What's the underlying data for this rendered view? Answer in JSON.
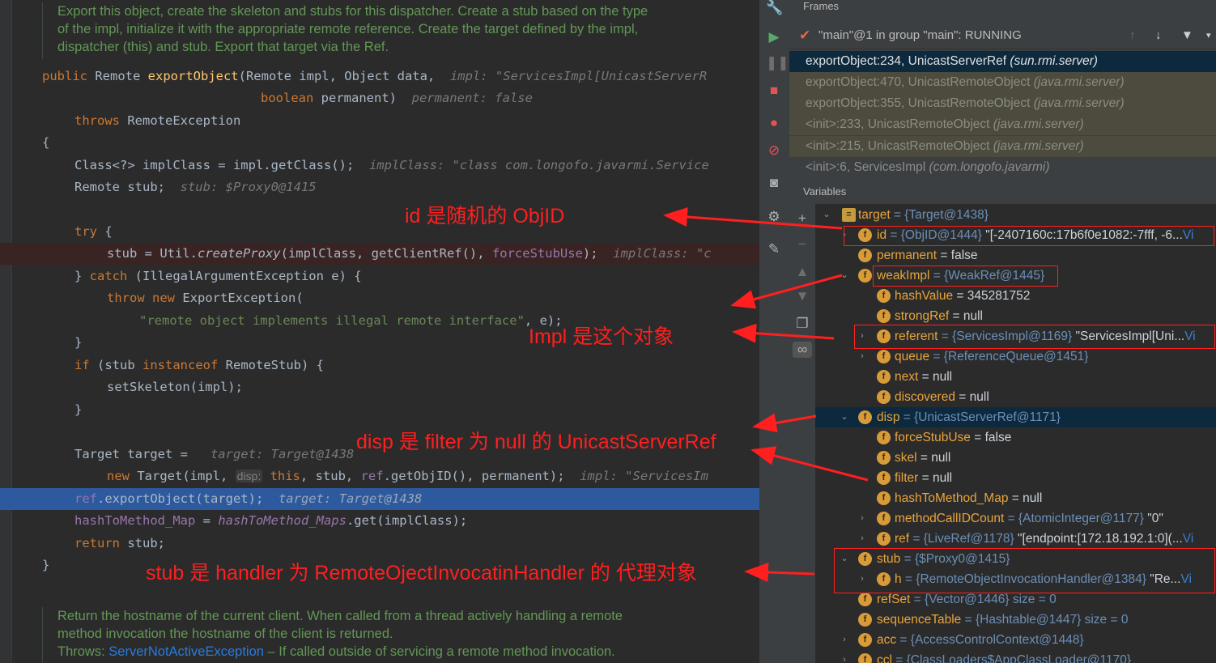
{
  "editor": {
    "doc_top": [
      "Export this object, create the skeleton and stubs for this dispatcher. Create a stub based on the type",
      "of the impl, initialize it with the appropriate remote reference. Create the target defined by the impl,",
      "dispatcher (this) and stub. Export that target via the Ref."
    ],
    "code": {
      "l1_kw": "public",
      "l1_text": " Remote ",
      "l1_fn": "exportObject",
      "l1_rest": "(Remote impl, Object data,",
      "l1_hint": "  impl: \"ServicesImpl[UnicastServerR",
      "l2_kw": "boolean",
      "l2_rest": " permanent)",
      "l2_hint": "  permanent: false",
      "l3_kw": "throws",
      "l3_rest": " RemoteException",
      "l4": "{",
      "l5_code": "Class<?> implClass = impl.getClass();",
      "l5_hint": "  implClass: \"class com.longofo.javarmi.Service",
      "l6_code": "Remote stub;",
      "l6_hint": "  stub: $Proxy0@1415",
      "l7_kw": "try",
      "l7_rest": " {",
      "l8_a": "stub = Util.",
      "l8_fn": "createProxy",
      "l8_b": "(implClass, getClientRef(), ",
      "l8_fld": "forceStubUse",
      "l8_c": ");",
      "l8_hint": "  implClass: \"c",
      "l9_a": "} ",
      "l9_kw": "catch",
      "l9_rest": " (IllegalArgumentException e) {",
      "l10_kw1": "throw",
      "l10_kw2": "new",
      "l10_rest": " ExportException(",
      "l11_str": "\"remote object implements illegal remote interface\"",
      "l11_rest": ", e);",
      "l12": "}",
      "l13_kw": "if",
      "l13_a": " (stub ",
      "l13_kw2": "instanceof",
      "l13_b": " RemoteStub) {",
      "l14": "setSkeleton(impl);",
      "l15": "}",
      "l16_code": "Target target = ",
      "l16_hint": "  target: Target@1438",
      "l17_kw": "new",
      "l17_a": " Target(impl, ",
      "l17_chip": "disp:",
      "l17_kw2": " this",
      "l17_b": ", stub, ",
      "l17_fld": "ref",
      "l17_c": ".getObjID(), permanent);",
      "l17_hint": "  impl: \"ServicesIm",
      "l18_fld": "ref",
      "l18_rest": ".exportObject(target);",
      "l18_hint": "  target: Target@1438",
      "l19_fld": "hashToMethod_Map",
      "l19_a": " = ",
      "l19_fld2": "hashToMethod_Maps",
      "l19_b": ".get(implClass);",
      "l20_kw": "return",
      "l20_rest": " stub;",
      "l21": "}"
    },
    "doc_bottom": [
      "Return the hostname of the current client. When called from a thread actively handling a remote",
      "method invocation the hostname of the client is returned."
    ],
    "doc_throws_label": "Throws: ",
    "doc_throws_link": "ServerNotActiveException",
    "doc_throws_rest": " – If called outside of servicing a remote method invocation."
  },
  "annotations": {
    "a1": "id 是随机的 ObjID",
    "a2": "Impl 是这个对象",
    "a3": "disp 是 filter 为 null 的 UnicastServerRef",
    "a4": "stub 是 handler 为 RemoteOjectInvocatinHandler 的 代理对象"
  },
  "frames": {
    "title": "Frames",
    "thread": "\"main\"@1 in group \"main\": RUNNING",
    "items": [
      {
        "loc": "exportObject:234, UnicastServerRef ",
        "pkg": "(sun.rmi.server)"
      },
      {
        "loc": "exportObject:470, UnicastRemoteObject ",
        "pkg": "(java.rmi.server)"
      },
      {
        "loc": "exportObject:355, UnicastRemoteObject ",
        "pkg": "(java.rmi.server)"
      },
      {
        "loc": "<init>:233, UnicastRemoteObject ",
        "pkg": "(java.rmi.server)"
      },
      {
        "loc": "<init>:215, UnicastRemoteObject ",
        "pkg": "(java.rmi.server)"
      },
      {
        "loc": "<init>:6, ServicesImpl ",
        "pkg": "(com.longofo.javarmi)"
      }
    ]
  },
  "variables": {
    "title": "Variables",
    "rows": [
      {
        "name": "target",
        "val": " = {Target@1438}",
        "str": ""
      },
      {
        "name": "id",
        "val": " = {ObjID@1444} ",
        "str": "\"[-2407160c:17b6f0e1082:-7fff, -6...",
        "link": "Vi"
      },
      {
        "name": "permanent",
        "val": " = false",
        "str": ""
      },
      {
        "name": "weakImpl",
        "val": " = {WeakRef@1445}",
        "str": ""
      },
      {
        "name": "hashValue",
        "val": " = 345281752",
        "str": ""
      },
      {
        "name": "strongRef",
        "val": " = null",
        "str": ""
      },
      {
        "name": "referent",
        "val": " = {ServicesImpl@1169} ",
        "str": "\"ServicesImpl[Uni...",
        "link": "Vi"
      },
      {
        "name": "queue",
        "val": " = {ReferenceQueue@1451}",
        "str": ""
      },
      {
        "name": "next",
        "val": " = null",
        "str": ""
      },
      {
        "name": "discovered",
        "val": " = null",
        "str": ""
      },
      {
        "name": "disp",
        "val": " = {UnicastServerRef@1171}",
        "str": ""
      },
      {
        "name": "forceStubUse",
        "val": " = false",
        "str": ""
      },
      {
        "name": "skel",
        "val": " = null",
        "str": ""
      },
      {
        "name": "filter",
        "val": " = null",
        "str": ""
      },
      {
        "name": "hashToMethod_Map",
        "val": " = null",
        "str": ""
      },
      {
        "name": "methodCallIDCount",
        "val": " = {AtomicInteger@1177} ",
        "str": "\"0\""
      },
      {
        "name": "ref",
        "val": " = {LiveRef@1178} ",
        "str": "\"[endpoint:[172.18.192.1:0](...",
        "link": "Vi"
      },
      {
        "name": "stub",
        "val": " = {$Proxy0@1415}",
        "str": ""
      },
      {
        "name": "h",
        "val": " = {RemoteObjectInvocationHandler@1384} ",
        "str": "\"Re...",
        "link": "Vi"
      },
      {
        "name": "refSet",
        "val": " = {Vector@1446}  size = 0",
        "str": ""
      },
      {
        "name": "sequenceTable",
        "val": " = {Hashtable@1447}  size = 0",
        "str": ""
      },
      {
        "name": "acc",
        "val": " = {AccessControlContext@1448}",
        "str": ""
      },
      {
        "name": "ccl",
        "val": " = {ClassLoaders$AppClassLoader@1170}",
        "str": ""
      }
    ]
  },
  "icons": {
    "thread_check": "check-icon",
    "field": "field-icon"
  }
}
